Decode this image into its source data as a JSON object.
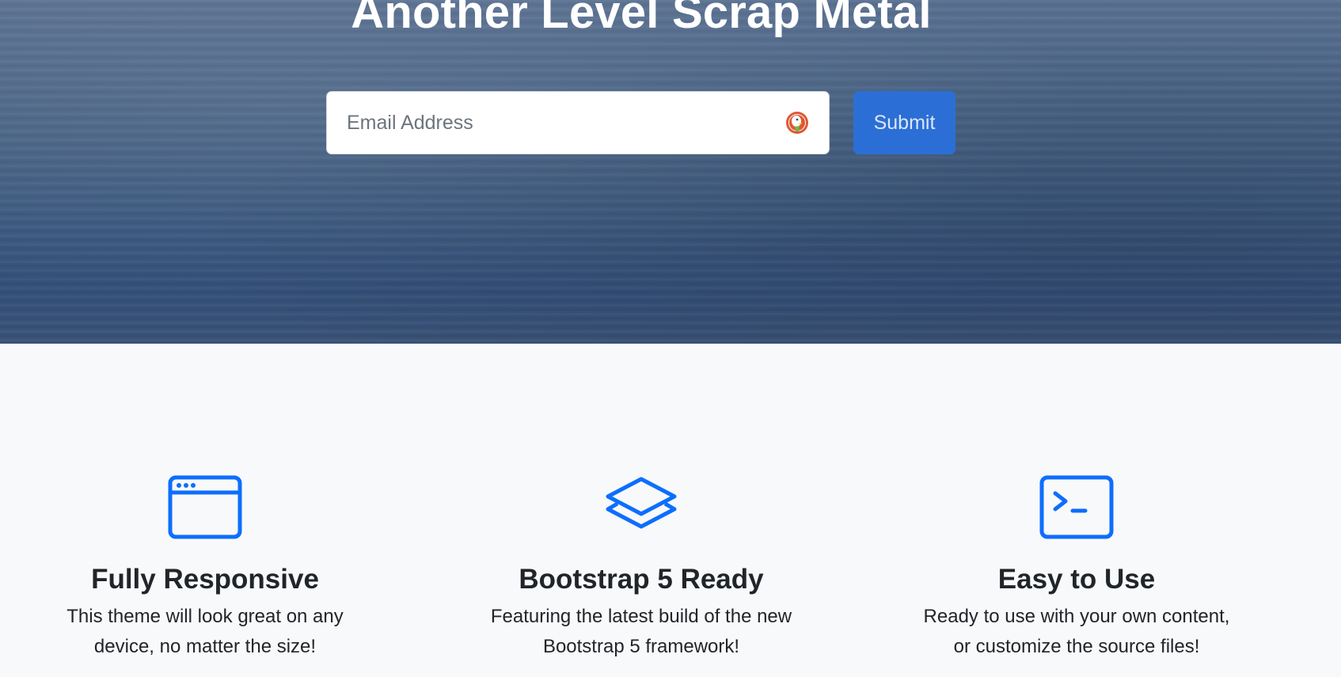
{
  "hero": {
    "title": "Another Level Scrap Metal",
    "email_placeholder": "Email Address",
    "submit_label": "Submit"
  },
  "features": [
    {
      "icon": "window-icon",
      "title": "Fully Responsive",
      "text_line1": "This theme will look great on any",
      "text_line2": "device, no matter the size!"
    },
    {
      "icon": "layers-icon",
      "title": "Bootstrap 5 Ready",
      "text_line1": "Featuring the latest build of the new",
      "text_line2": "Bootstrap 5 framework!"
    },
    {
      "icon": "terminal-icon",
      "title": "Easy to Use",
      "text_line1": "Ready to use with your own content,",
      "text_line2": "or customize the source files!"
    }
  ],
  "colors": {
    "accent": "#0d6efd",
    "submit_bg": "#2b6fd6",
    "section_bg": "#f8f9fa"
  }
}
